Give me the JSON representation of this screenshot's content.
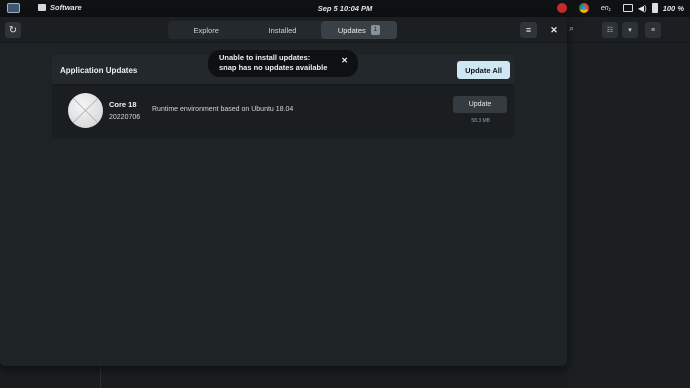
{
  "topbar": {
    "app_name": "Software",
    "clock": "Sep 5  10:04 PM",
    "keyboard_layout": "en₁",
    "volume_icon": "◀)",
    "battery_percent": "100 %"
  },
  "headerbar": {
    "refresh_glyph": "↻",
    "tabs": [
      {
        "label": "Explore"
      },
      {
        "label": "Installed"
      },
      {
        "label": "Updates",
        "badge": "1"
      }
    ],
    "menu_glyph": "≡",
    "close_glyph": "✕"
  },
  "notification": {
    "line1": "Unable to install updates:",
    "line2": "snap has no updates available",
    "close_glyph": "✕"
  },
  "updates_panel": {
    "title": "Application Updates",
    "update_all_label": "Update All",
    "items": [
      {
        "name": "Core 18",
        "version": "20220706",
        "description": "Runtime environment based on Ubuntu 18.04",
        "button_label": "Update",
        "size": "58.3 MB"
      }
    ]
  },
  "background_window": {
    "search_glyph": "⌕",
    "view_glyph": "☷",
    "dropdown_glyph": "▾",
    "menu_glyph": "≡"
  },
  "colors": {
    "accent_button": "#cfe6f3",
    "window_bg": "#1e2326",
    "topbar_bg": "#0f1112"
  }
}
